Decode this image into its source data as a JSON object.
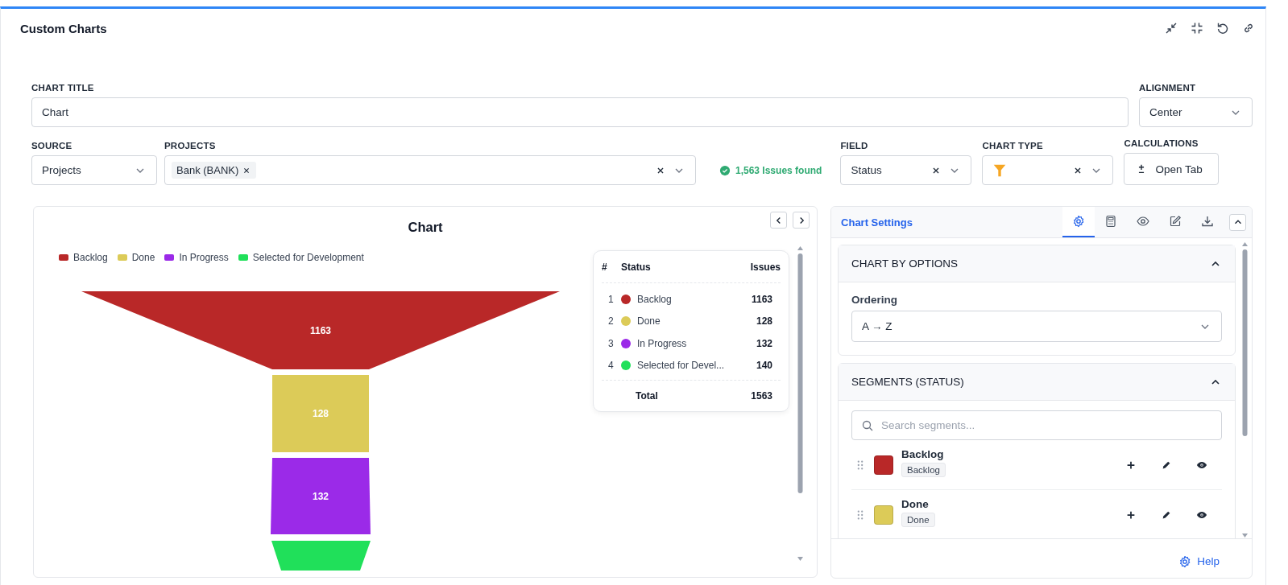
{
  "title": "Custom Charts",
  "form": {
    "chart_title": {
      "label": "CHART TITLE",
      "value": "Chart"
    },
    "alignment": {
      "label": "ALIGNMENT",
      "value": "Center"
    },
    "source": {
      "label": "SOURCE",
      "value": "Projects"
    },
    "projects": {
      "label": "PROJECTS",
      "chips": [
        "Bank (BANK)"
      ]
    },
    "issues_found": "1,563 Issues found",
    "field": {
      "label": "FIELD",
      "value": "Status"
    },
    "chart_type": {
      "label": "CHART TYPE"
    },
    "calculations": {
      "label": "CALCULATIONS",
      "button": "Open Tab"
    }
  },
  "chart": {
    "title": "Chart",
    "legend": [
      {
        "label": "Backlog",
        "color": "#b92828"
      },
      {
        "label": "Done",
        "color": "#dccb58"
      },
      {
        "label": "In Progress",
        "color": "#9b2ae8"
      },
      {
        "label": "Selected for Development",
        "color": "#20e05a"
      }
    ],
    "funnel": [
      {
        "value": "1163",
        "color": "#b92828"
      },
      {
        "value": "128",
        "color": "#dccb58"
      },
      {
        "value": "132",
        "color": "#9b2ae8"
      },
      {
        "color": "#20e05a"
      }
    ],
    "summary": {
      "columns": [
        "#",
        "Status",
        "Issues"
      ],
      "rows": [
        {
          "index": "1",
          "status": "Backlog",
          "issues": "1163",
          "color": "#b92828"
        },
        {
          "index": "2",
          "status": "Done",
          "issues": "128",
          "color": "#dccb58"
        },
        {
          "index": "3",
          "status": "In Progress",
          "issues": "132",
          "color": "#9b2ae8"
        },
        {
          "index": "4",
          "status": "Selected for Devel...",
          "issues": "140",
          "color": "#20e05a"
        }
      ],
      "total": {
        "label": "Total",
        "value": "1563"
      }
    }
  },
  "settings": {
    "title": "Chart Settings",
    "tabs": [
      {
        "kind": "settings",
        "selected": true
      },
      {
        "kind": "calculator",
        "selected": false
      },
      {
        "kind": "view",
        "selected": false
      },
      {
        "kind": "edit",
        "selected": false
      },
      {
        "kind": "download",
        "selected": false
      }
    ],
    "sections": [
      {
        "kind": "options",
        "title": "CHART BY OPTIONS",
        "expanded": true,
        "label": "Ordering",
        "value": "A → Z"
      },
      {
        "kind": "segments",
        "title": "SEGMENTS (STATUS)",
        "expanded": true,
        "search_placeholder": "Search segments...",
        "segments": [
          {
            "name": "Backlog",
            "tag": "Backlog",
            "color": "#b92828"
          },
          {
            "name": "Done",
            "tag": "Done",
            "color": "#dccb58"
          }
        ]
      }
    ],
    "help": "Help"
  }
}
